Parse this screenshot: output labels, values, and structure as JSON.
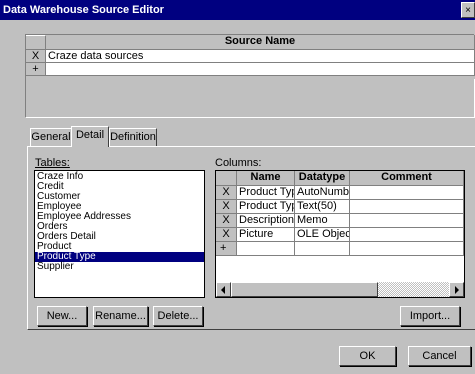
{
  "window": {
    "title": "Data Warehouse Source Editor",
    "close_glyph": "×"
  },
  "source_grid": {
    "header": "Source Name",
    "rows": [
      {
        "marker": "X",
        "name": "Craze data sources"
      }
    ],
    "new_row_marker": "+"
  },
  "tabs": [
    {
      "label": "General",
      "active": false
    },
    {
      "label": "Detail",
      "active": true
    },
    {
      "label": "Definition",
      "active": false
    }
  ],
  "tables": {
    "label": "Tables:",
    "items": [
      "Craze Info",
      "Credit",
      "Customer",
      "Employee",
      "Employee Addresses",
      "Orders",
      "Orders Detail",
      "Product",
      "Product Type",
      "Supplier"
    ],
    "selected_index": 8
  },
  "columns": {
    "label": "Columns:",
    "headers": [
      "Name",
      "Datatype",
      "Comment"
    ],
    "rows": [
      {
        "marker": "X",
        "name": "Product Typ",
        "datatype": "AutoNumber",
        "comment": ""
      },
      {
        "marker": "X",
        "name": "Product Typ",
        "datatype": "Text(50)",
        "comment": ""
      },
      {
        "marker": "X",
        "name": "Description",
        "datatype": "Memo",
        "comment": ""
      },
      {
        "marker": "X",
        "name": "Picture",
        "datatype": "OLE Object",
        "comment": ""
      }
    ],
    "new_row_marker": "+"
  },
  "buttons": {
    "new": "New...",
    "rename": "Rename...",
    "delete": "Delete...",
    "import": "Import...",
    "ok": "OK",
    "cancel": "Cancel"
  }
}
